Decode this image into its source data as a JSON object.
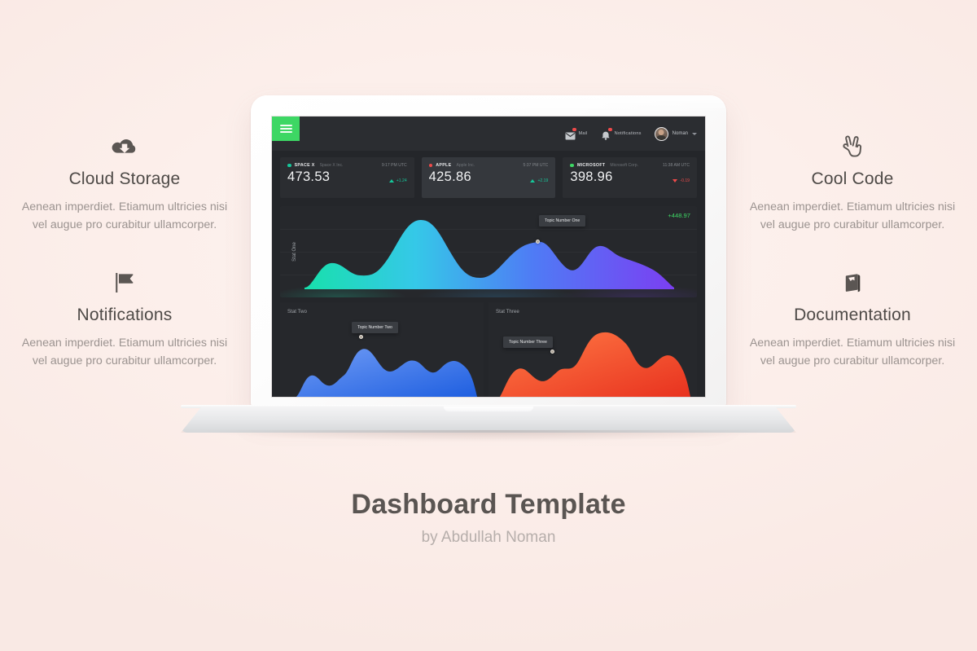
{
  "features": [
    {
      "icon": "cloud-download-icon",
      "title": "Cloud Storage",
      "desc": "Aenean imperdiet. Etiamum ultricies nisi vel augue pro curabitur ullamcorper."
    },
    {
      "icon": "flag-icon",
      "title": "Notifications",
      "desc": "Aenean imperdiet. Etiamum ultricies nisi vel augue pro curabitur ullamcorper."
    },
    {
      "icon": "peace-hand-icon",
      "title": "Cool Code",
      "desc": "Aenean imperdiet. Etiamum ultricies nisi vel augue pro curabitur ullamcorper."
    },
    {
      "icon": "book-icon",
      "title": "Documentation",
      "desc": "Aenean imperdiet. Etiamum ultricies nisi vel augue pro curabitur ullamcorper."
    }
  ],
  "dashboard": {
    "menu_icon": "hamburger-menu-icon",
    "menu_color": "#3dd764",
    "nav": [
      {
        "icon": "mail-icon",
        "label": "Mail",
        "badge_color": "#ef4a4a"
      },
      {
        "icon": "bell-icon",
        "label": "Notifications",
        "badge_color": "#ef4a4a"
      }
    ],
    "user": {
      "name": "Noman",
      "avatar": "user-avatar",
      "caret": "chevron-down-icon"
    },
    "cards": [
      {
        "symbol": "SPACE X",
        "company": "Space X Inc.",
        "time": "9:17 PM UTC",
        "price": "473.53",
        "change": "+1.24",
        "direction": "up",
        "tick_color": "#16c79a",
        "active": false
      },
      {
        "symbol": "APPLE",
        "company": "Apple Inc.",
        "time": "5:37 PM UTC",
        "price": "425.86",
        "change": "+2.19",
        "direction": "up",
        "tick_color": "#ef4a4a",
        "active": true
      },
      {
        "symbol": "MICROSOFT",
        "company": "Microsoft Corp.",
        "time": "11:38 AM UTC",
        "price": "398.96",
        "change": "-0.19",
        "direction": "down",
        "tick_color": "#3dd764",
        "active": false
      }
    ],
    "charts": {
      "main": {
        "label": "Stat One",
        "tooltip": "Topic Number One",
        "total": "+448.97",
        "color_start": "#18e0ac",
        "color_end": "#7b3ff2"
      },
      "left": {
        "label": "Stat Two",
        "tooltip": "Topic Number Two",
        "color_start": "#5b8def",
        "color_end": "#1f5fe0"
      },
      "right": {
        "label": "Stat Three",
        "tooltip": "Topic Number Three",
        "color_start": "#ff6a3d",
        "color_end": "#e8321f"
      }
    }
  },
  "footer": {
    "title": "Dashboard Template",
    "byline": "by Abdullah Noman"
  },
  "chart_data": {
    "type": "area",
    "title": "Stat One",
    "charts": [
      {
        "name": "Stat One",
        "type": "area",
        "total_label": "+448.97",
        "annotation": "Topic Number One",
        "gradient": [
          "#18e0ac",
          "#35c8e8",
          "#4f7bf5",
          "#7b3ff2"
        ],
        "x": [
          0,
          1,
          2,
          3,
          4,
          5,
          6,
          7,
          8,
          9,
          10,
          11,
          12,
          13,
          14,
          15,
          16
        ],
        "values": [
          0,
          38,
          46,
          30,
          28,
          68,
          96,
          72,
          34,
          26,
          44,
          76,
          62,
          44,
          66,
          58,
          40
        ],
        "marker_index": 11,
        "ylim": [
          0,
          100
        ],
        "grid": true
      },
      {
        "name": "Stat Two",
        "type": "area",
        "annotation": "Topic Number Two",
        "gradient": [
          "#6f9bf5",
          "#1f5fe0"
        ],
        "x": [
          0,
          1,
          2,
          3,
          4,
          5,
          6,
          7,
          8,
          9,
          10,
          11,
          12
        ],
        "values": [
          8,
          34,
          30,
          14,
          30,
          66,
          52,
          38,
          56,
          44,
          28,
          56,
          48
        ],
        "marker_index": 5,
        "ylim": [
          0,
          80
        ],
        "grid": false
      },
      {
        "name": "Stat Three",
        "type": "area",
        "annotation": "Topic Number Three",
        "gradient": [
          "#ff7a45",
          "#e8321f"
        ],
        "x": [
          0,
          1,
          2,
          3,
          4,
          5,
          6,
          7,
          8,
          9,
          10
        ],
        "values": [
          6,
          30,
          34,
          22,
          26,
          62,
          78,
          70,
          44,
          62,
          54
        ],
        "marker_index": 4,
        "ylim": [
          0,
          90
        ],
        "grid": false
      }
    ]
  }
}
